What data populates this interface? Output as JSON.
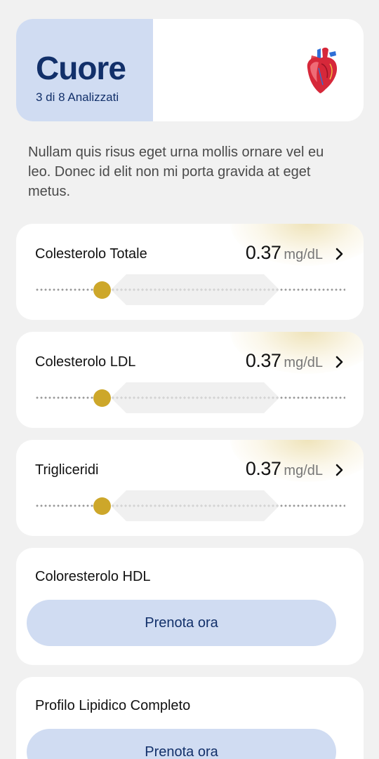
{
  "header": {
    "title": "Cuore",
    "subtitle": "3 di 8 Analizzati",
    "icon": "heart-icon"
  },
  "description": "Nullam quis risus eget urna mollis ornare vel eu leo. Donec id elit non mi porta gravida at eget metus.",
  "metrics": [
    {
      "name": "Colesterolo Totale",
      "value": "0.37",
      "unit": "mg/dL"
    },
    {
      "name": "Colesterolo LDL",
      "value": "0.37",
      "unit": "mg/dL"
    },
    {
      "name": "Trigliceridi",
      "value": "0.37",
      "unit": "mg/dL"
    }
  ],
  "bookings": [
    {
      "name": "Coloresterolo HDL",
      "button": "Prenota ora"
    },
    {
      "name": "Profilo Lipidico Completo",
      "button": "Prenota ora"
    }
  ],
  "colors": {
    "accent": "#12306a",
    "accent_bg": "#d0dcf2",
    "knob": "#cda72a"
  }
}
